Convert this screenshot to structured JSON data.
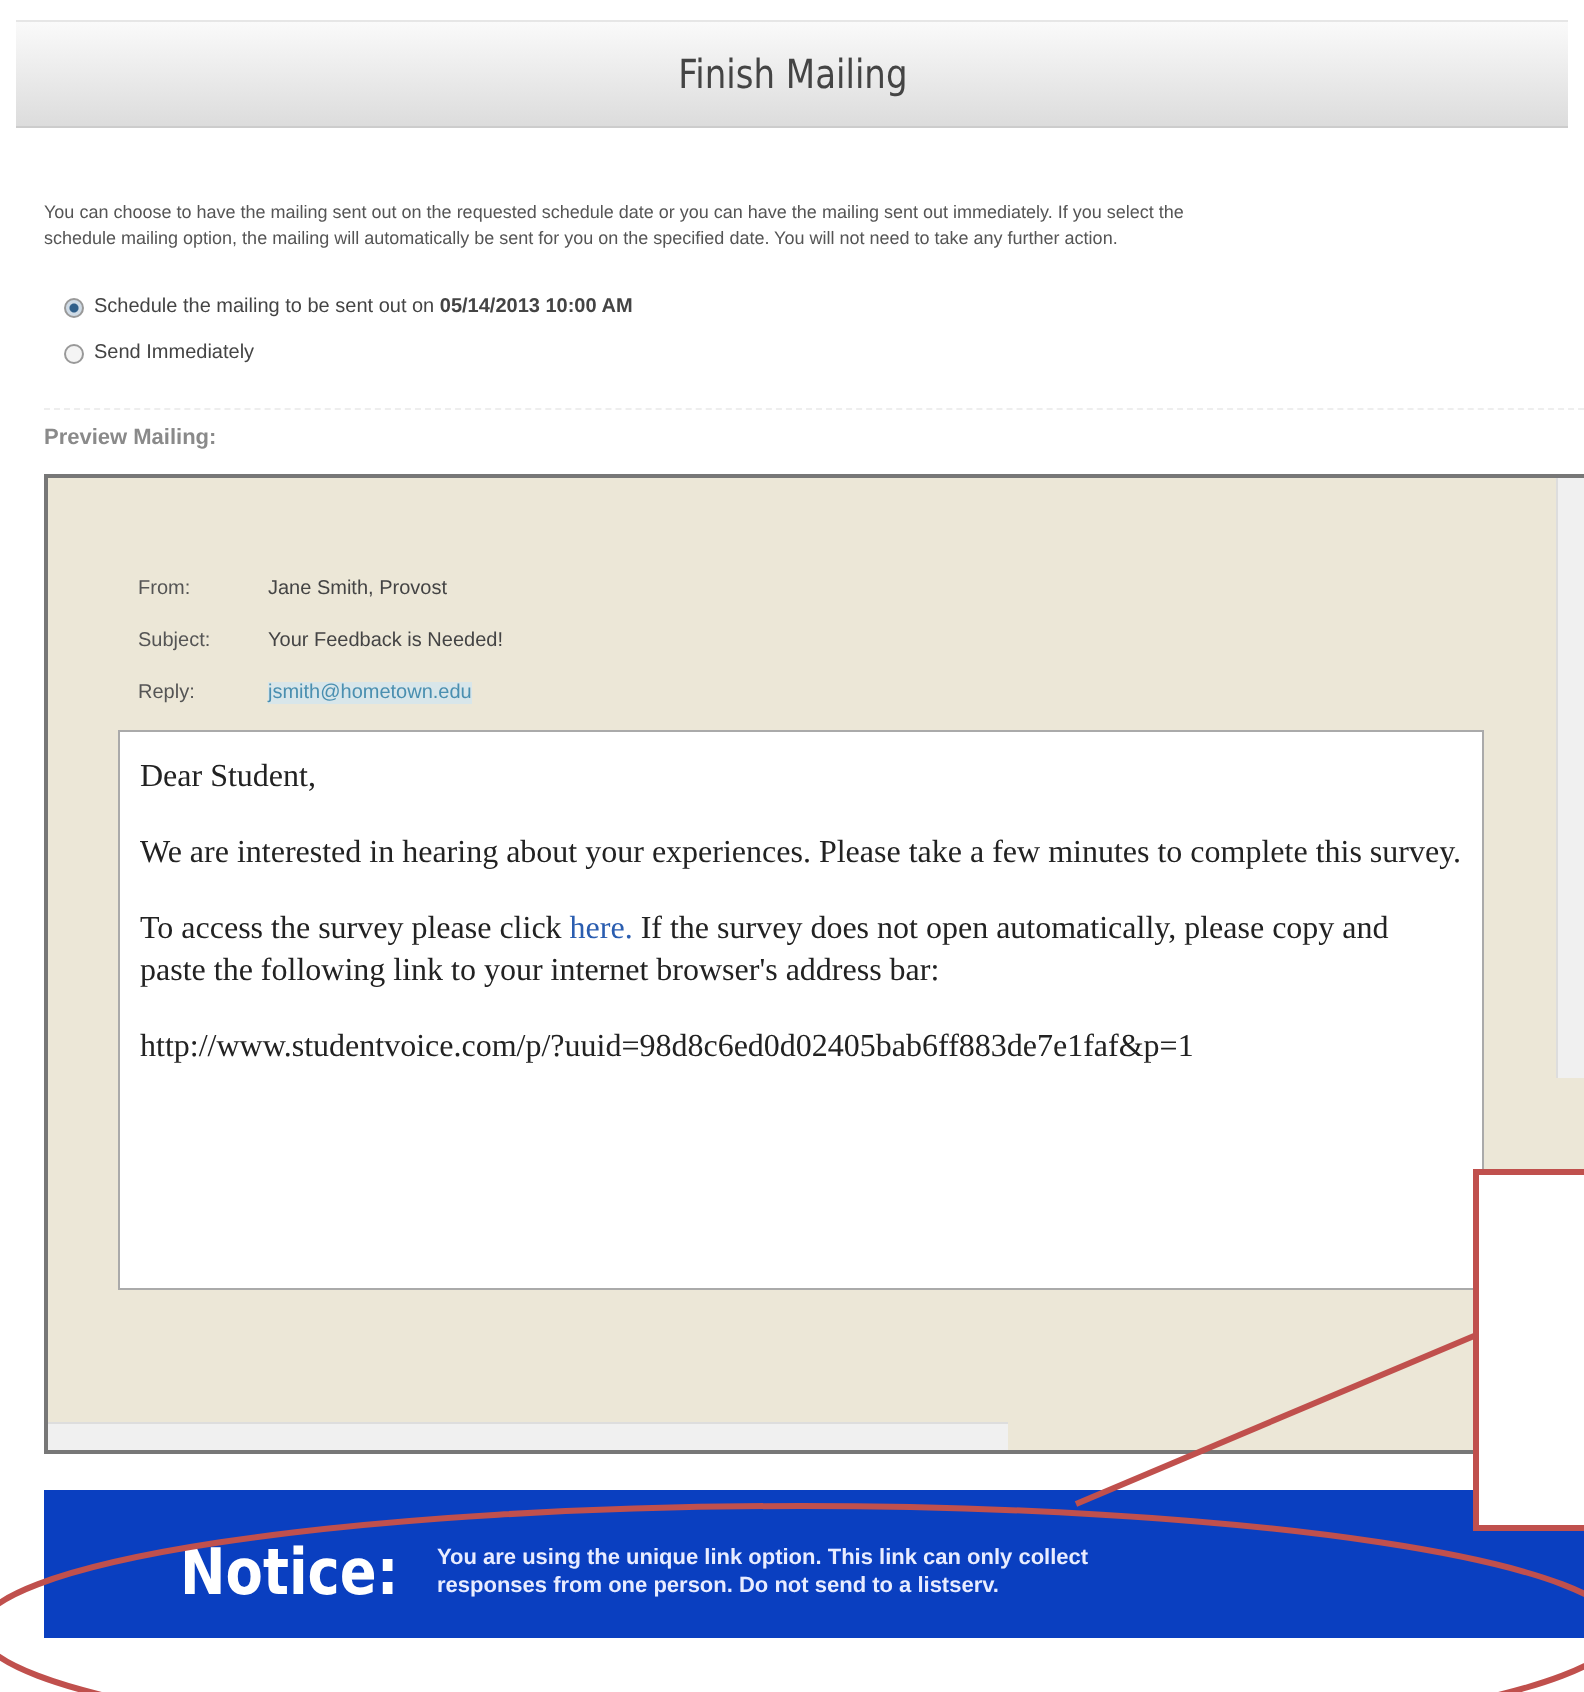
{
  "header": {
    "title": "Finish Mailing"
  },
  "intro": "You can choose to have the mailing sent out on the requested schedule date or you can have the mailing sent out immediately. If you select the schedule mailing option, the mailing will automatically be sent for you on the specified date. You will not need to take any further action.",
  "options": [
    {
      "label": "Schedule the mailing to be sent out on **05/14/2013 10:00 AM**",
      "selected": true
    },
    {
      "label": "Send Immediately",
      "selected": false
    }
  ],
  "preview": {
    "heading": "Preview Mailing:",
    "fields": [
      {
        "label": "From:",
        "value": "Jane Smith, Provost",
        "kind": "text"
      },
      {
        "label": "Subject:",
        "value": "Your Feedback is Needed!",
        "kind": "text"
      },
      {
        "label": "Reply:",
        "value": "jsmith@hometown.edu",
        "kind": "link"
      }
    ],
    "greeting": "Dear Student,",
    "paragraph_1": "We are interested in hearing about your experiences. Please take a few minutes to complete this survey.",
    "paragraph_2": {
      "before": "To access the survey please click",
      "link": "here.",
      "after": "If the survey does not open automatically, please copy and paste the following link to your internet browser's address bar:"
    },
    "url": "http://www.studentvoice.com/p/?uuid=98d8c6ed0d02405bab6ff883de7e1faf&p=1"
  },
  "notice": {
    "label": "Notice:",
    "text": "You are using the unique link option. This link can only collect responses from one person. Do not send to a listserv."
  }
}
